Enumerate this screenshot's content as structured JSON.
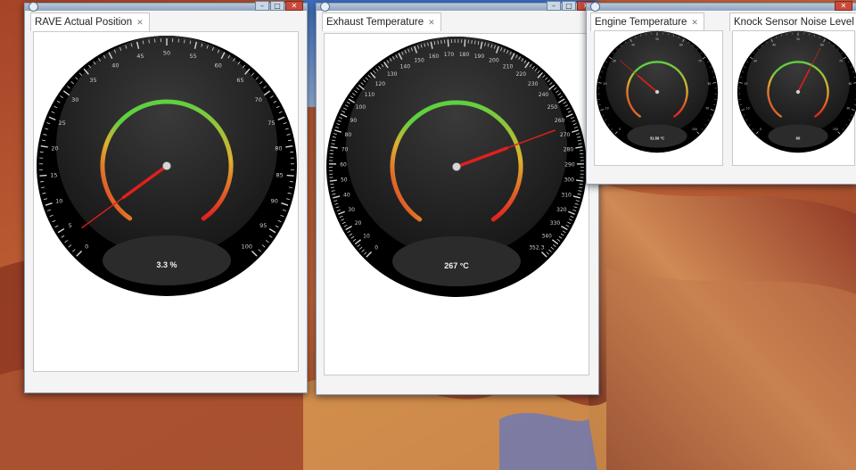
{
  "colors": {
    "window_frame": "#8da3bd",
    "window_bg": "#f4f4f4",
    "gauge_bezel": "#000000",
    "gauge_face": "#2a2a2a",
    "needle": "#e0201c",
    "arc_good": "#5fd040",
    "arc_warn": "#e0b030",
    "arc_bad": "#e02020"
  },
  "window_controls": {
    "minimize": "–",
    "maximize": "□",
    "close": "✕"
  },
  "gauges": [
    {
      "title": "RAVE Actual Position",
      "close_glyph": "✕",
      "readout": "3.3 %",
      "value": 3.3,
      "min": 0,
      "max": 100,
      "tick_labels": [
        "0",
        "5",
        "10",
        "15",
        "20",
        "25",
        "30",
        "35",
        "40",
        "45",
        "50",
        "55",
        "60",
        "65",
        "70",
        "75",
        "80",
        "85",
        "90",
        "95",
        "100"
      ]
    },
    {
      "title": "Exhaust Temperature",
      "close_glyph": "✕",
      "readout": "267 °C",
      "value": 267,
      "min": 0,
      "max": 352.3,
      "tick_labels": [
        "0",
        "10",
        "20",
        "30",
        "40",
        "50",
        "60",
        "70",
        "80",
        "90",
        "100",
        "110",
        "120",
        "130",
        "140",
        "150",
        "160",
        "170",
        "180",
        "190",
        "200",
        "210",
        "220",
        "230",
        "240",
        "250",
        "260",
        "270",
        "280",
        "290",
        "300",
        "310",
        "320",
        "330",
        "340",
        "352.3"
      ]
    },
    {
      "title": "Engine Temperature",
      "close_glyph": "✕",
      "readout": "31.56 °C",
      "value": 31.56,
      "min": 0,
      "max": 100,
      "tick_labels": [
        "0",
        "10",
        "20",
        "30",
        "40",
        "50",
        "60",
        "70",
        "80",
        "90",
        "100"
      ]
    },
    {
      "title": "Knock Sensor Noise Level",
      "close_glyph": "✕",
      "readout": "60",
      "value": 60,
      "min": 0,
      "max": 100,
      "tick_labels": [
        "0",
        "10",
        "20",
        "30",
        "40",
        "50",
        "60",
        "70",
        "80",
        "90",
        "100"
      ]
    }
  ]
}
